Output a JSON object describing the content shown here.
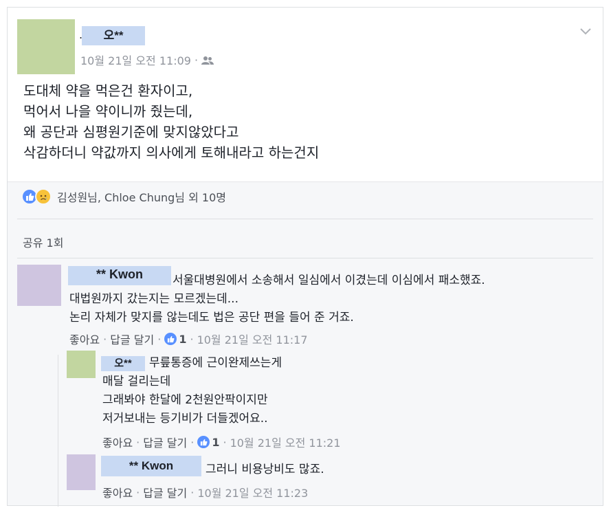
{
  "post": {
    "author": "오**",
    "prefix_dot": ".",
    "timestamp": "10월 21일 오전 11:09",
    "privacy_sep": "·",
    "icons": {
      "privacy": "friends-icon",
      "menu": "chevron-down-icon"
    },
    "text": "도대체 약을 먹은건 환자이고,\n먹어서 나을 약이니까 줬는데,\n왜 공단과 심평원기준에 맞지않았다고\n삭감하더니 약값까지 의사에게 토해내라고 하는건지"
  },
  "reactions": {
    "icons": [
      "like-icon",
      "sad-icon"
    ],
    "summary": "김성원님, Chloe Chung님 외 10명"
  },
  "shares": {
    "label": "공유 1회"
  },
  "comments": [
    {
      "author": "** Kwon",
      "text_first": "서울대병원에서 소송해서 일심에서 이겼는데 이심에서 패소했죠.",
      "text_rest": "대법원까지 갔는지는 모르겠는데...\n논리 자체가 맞지를 않는데도 법은 공단 편을 들어 준 거죠.",
      "like_label": "좋아요",
      "reply_label": "답글 달기",
      "like_count": "1",
      "timestamp": "10월 21일 오전 11:17"
    },
    {
      "author": "오**",
      "text_first": "무릎통증에 근이완제쓰는게",
      "text_rest": "매달 걸리는데\n그래봐야 한달에 2천원안팍이지만\n저거보내는 등기비가 더들겠어요..",
      "like_label": "좋아요",
      "reply_label": "답글 달기",
      "like_count": "1",
      "timestamp": "10월 21일 오전 11:21"
    },
    {
      "author": "** Kwon",
      "text_first": "그러니 비용낭비도 많죠.",
      "like_label": "좋아요",
      "reply_label": "답글 달기",
      "timestamp": "10월 21일 오전 11:23"
    }
  ],
  "separator": "·",
  "colors": {
    "like_blue": "#5890ff",
    "name_highlight": "#c8d9f3",
    "post_avatar": "#c2d6a0",
    "comment_avatar": "#cfc5e0",
    "meta_gray": "#90949c",
    "panel_bg": "#f6f7f9"
  }
}
